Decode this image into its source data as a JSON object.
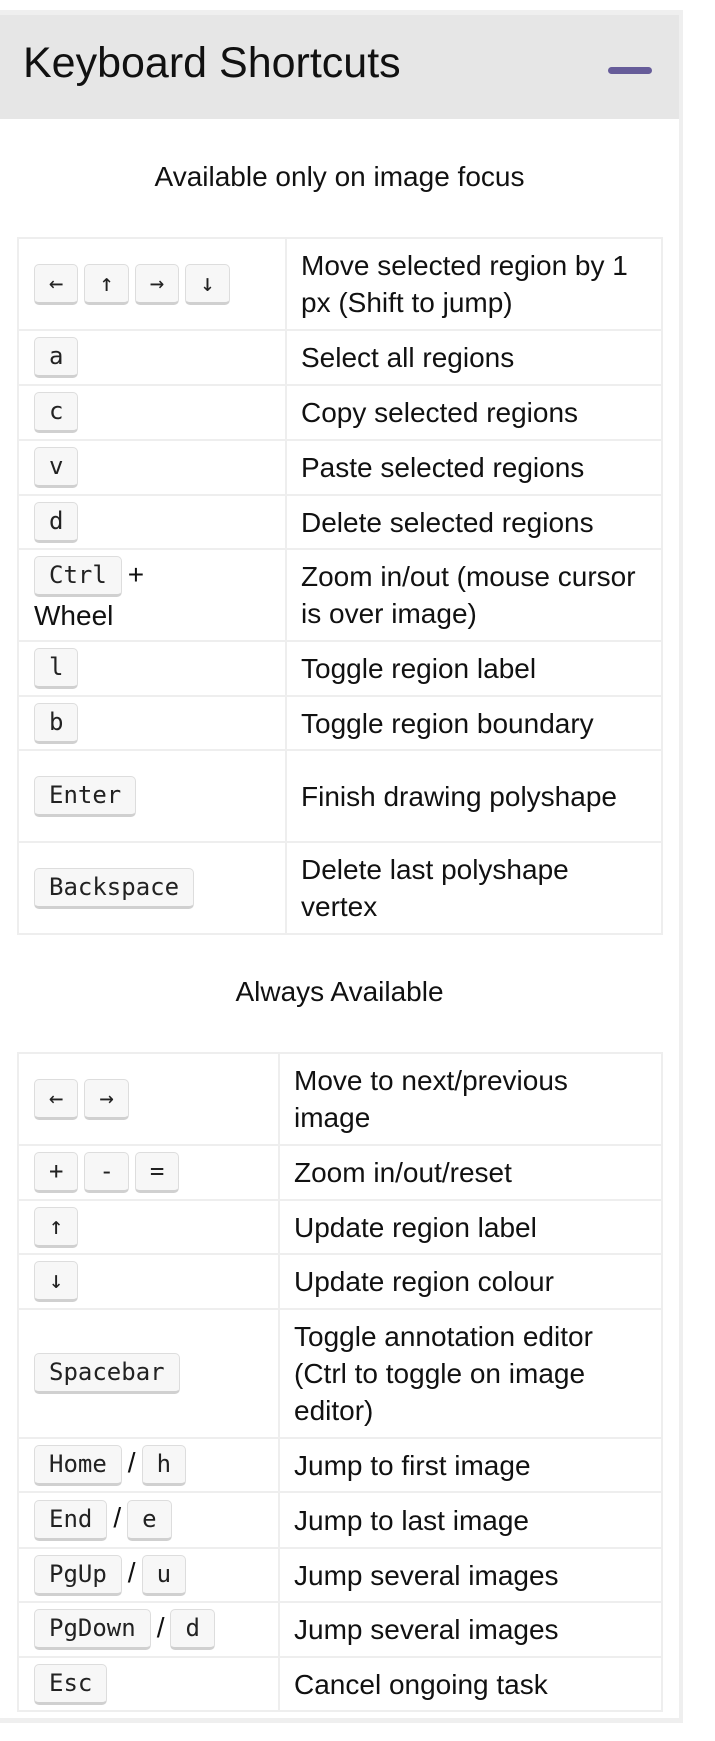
{
  "panel": {
    "title": "Keyboard Shortcuts",
    "accent": "#665c99"
  },
  "sections": [
    {
      "heading": "Available only on image focus",
      "rows": [
        {
          "keys": [
            {
              "k": "←"
            },
            {
              "k": "↑"
            },
            {
              "k": "→"
            },
            {
              "k": "↓"
            }
          ],
          "desc": "Move selected region by 1 px (Shift to jump)"
        },
        {
          "keys": [
            {
              "k": "a"
            }
          ],
          "desc": "Select all regions"
        },
        {
          "keys": [
            {
              "k": "c"
            }
          ],
          "desc": "Copy selected regions"
        },
        {
          "keys": [
            {
              "k": "v"
            }
          ],
          "desc": "Paste selected regions"
        },
        {
          "keys": [
            {
              "k": "d"
            }
          ],
          "desc": "Delete selected regions"
        },
        {
          "keys": [
            {
              "k": "Ctrl"
            },
            {
              "t": "+"
            },
            {
              "br": true
            },
            {
              "t": "Wheel"
            }
          ],
          "desc": "Zoom in/out (mouse cursor is over image)"
        },
        {
          "keys": [
            {
              "k": "l"
            }
          ],
          "desc": "Toggle region label"
        },
        {
          "keys": [
            {
              "k": "b"
            }
          ],
          "desc": "Toggle region boundary"
        },
        {
          "keys": [
            {
              "k": "Enter"
            }
          ],
          "desc": "Finish drawing polyshape"
        },
        {
          "keys": [
            {
              "k": "Backspace"
            }
          ],
          "desc": "Delete last polyshape vertex"
        }
      ]
    },
    {
      "heading": "Always Available",
      "rows": [
        {
          "keys": [
            {
              "k": "←"
            },
            {
              "k": "→"
            }
          ],
          "desc": "Move to next/previous image"
        },
        {
          "keys": [
            {
              "k": "+"
            },
            {
              "k": "-"
            },
            {
              "k": "="
            }
          ],
          "desc": "Zoom in/out/reset"
        },
        {
          "keys": [
            {
              "k": "↑"
            }
          ],
          "desc": "Update region label"
        },
        {
          "keys": [
            {
              "k": "↓"
            }
          ],
          "desc": "Update region colour"
        },
        {
          "keys": [
            {
              "k": "Spacebar"
            }
          ],
          "desc": "Toggle annotation editor (Ctrl to toggle on image editor)"
        },
        {
          "keys": [
            {
              "k": "Home"
            },
            {
              "t": "/"
            },
            {
              "k": "h"
            }
          ],
          "desc": "Jump to first image"
        },
        {
          "keys": [
            {
              "k": "End"
            },
            {
              "t": "/"
            },
            {
              "k": "e"
            }
          ],
          "desc": "Jump to last image"
        },
        {
          "keys": [
            {
              "k": "PgUp"
            },
            {
              "t": "/"
            },
            {
              "k": "u"
            }
          ],
          "desc": "Jump several images"
        },
        {
          "keys": [
            {
              "k": "PgDown"
            },
            {
              "t": "/"
            },
            {
              "k": "d"
            }
          ],
          "desc": "Jump several images"
        },
        {
          "keys": [
            {
              "k": "Esc"
            }
          ],
          "desc": "Cancel ongoing task"
        }
      ]
    }
  ]
}
